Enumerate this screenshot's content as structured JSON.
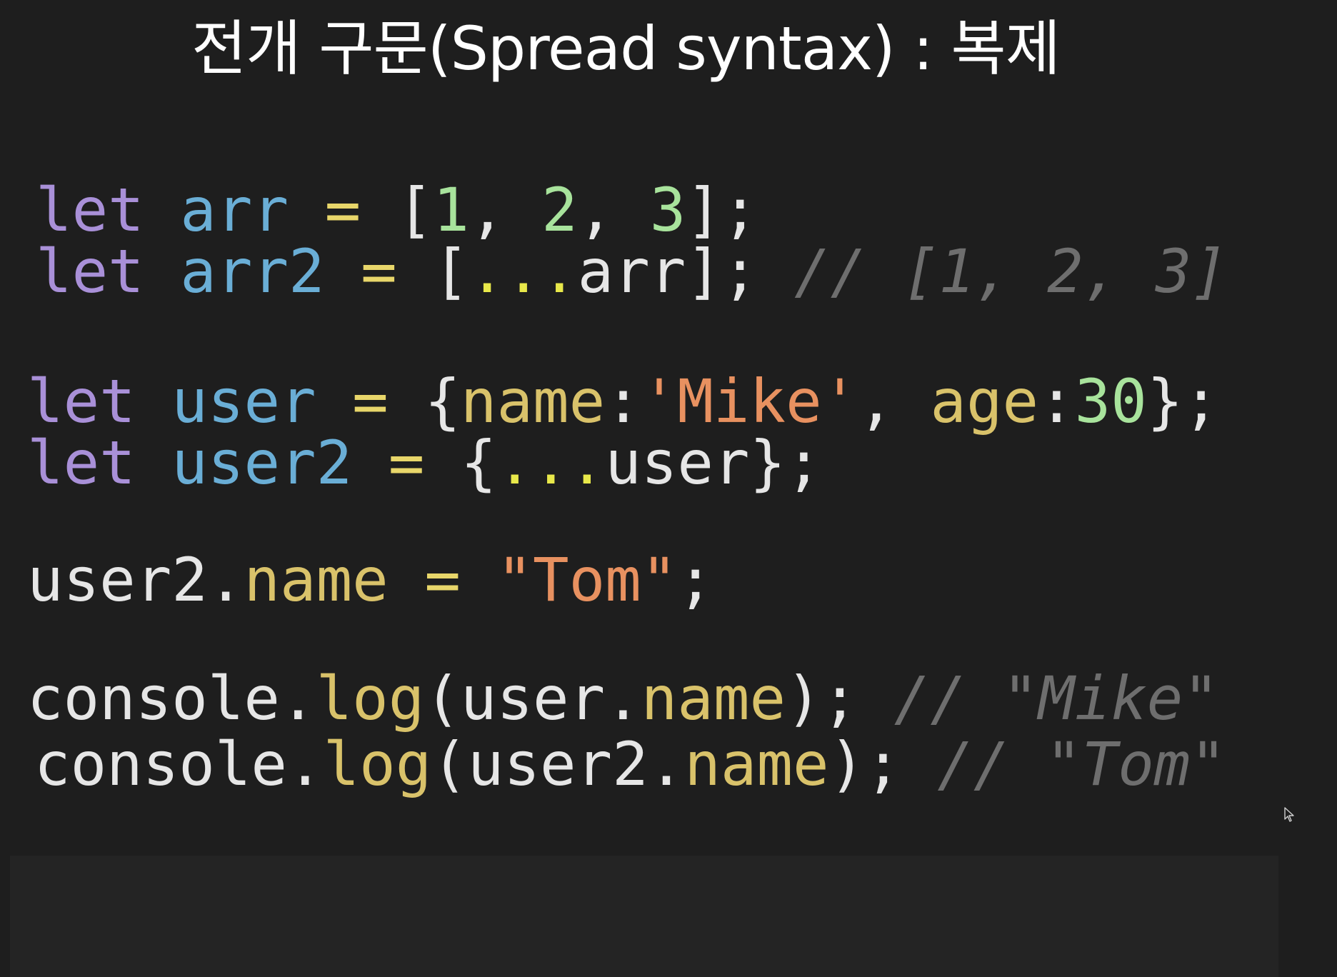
{
  "slide": {
    "title": "전개 구문(Spread syntax) : 복제"
  },
  "code": {
    "line1": {
      "kw": "let",
      "var": "arr",
      "op": "=",
      "open": "[",
      "n1": "1",
      "c1": ", ",
      "n2": "2",
      "c2": ", ",
      "n3": "3",
      "close": "];"
    },
    "line2": {
      "kw": "let",
      "var": "arr2",
      "op": "=",
      "open": "[",
      "spread": "...",
      "ref": "arr",
      "close": "];",
      "comment": "// [1, 2, 3]"
    },
    "line3": {
      "kw": "let",
      "var": "user",
      "op": "=",
      "open": "{",
      "k1": "name",
      "colon1": ":",
      "v1": "'Mike'",
      "sep": ", ",
      "k2": "age",
      "colon2": ":",
      "v2": "30",
      "close": "};"
    },
    "line4": {
      "kw": "let",
      "var": "user2",
      "op": "=",
      "open": "{",
      "spread": "...",
      "ref": "user",
      "close": "};"
    },
    "line5": {
      "obj": "user2.",
      "prop": "name",
      "op": "=",
      "val": "\"Tom\"",
      "end": ";"
    },
    "line6": {
      "obj": "console.",
      "fn": "log",
      "open": "(user.",
      "prop": "name",
      "close": ");",
      "comment": "// \"Mike\""
    },
    "line7": {
      "obj": "console.",
      "fn": "log",
      "open": "(user2.",
      "prop": "name",
      "close": ");",
      "comment": "// \"Tom\""
    }
  },
  "colors": {
    "background": "#1e1e1e",
    "keyword": "#a990d8",
    "variable": "#6aaed6",
    "operator": "#e8d66a",
    "number": "#a8e39c",
    "property": "#d9c26a",
    "string": "#e89160",
    "comment": "#6e6e6e"
  }
}
